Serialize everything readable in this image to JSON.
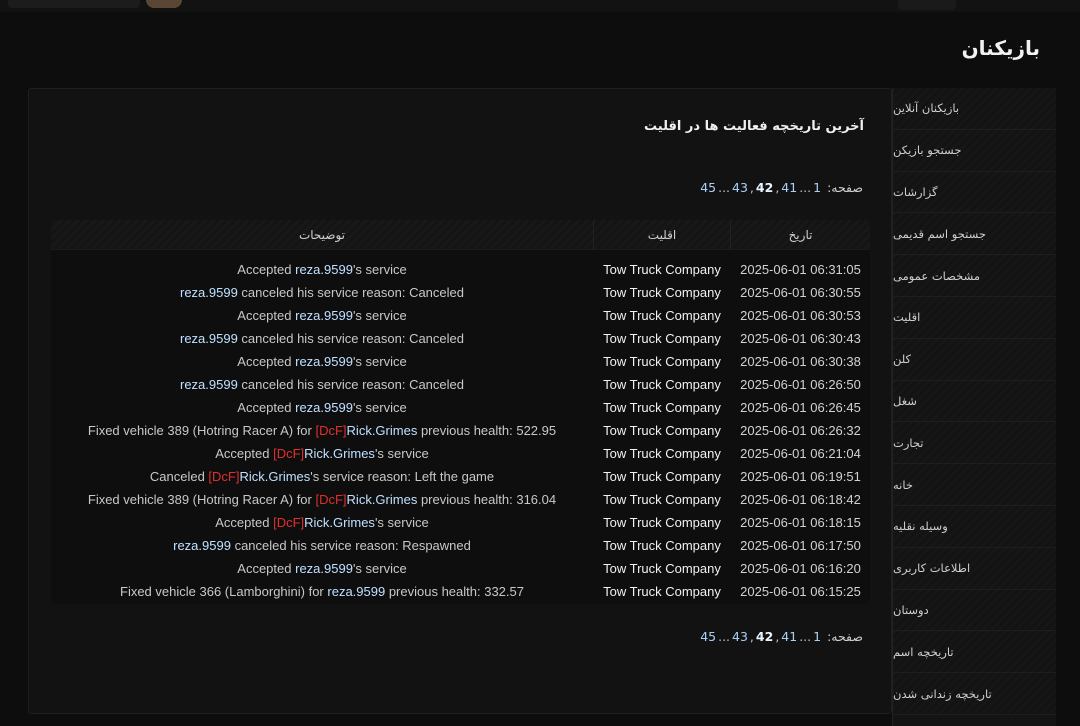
{
  "page": {
    "title": "بازیکنان"
  },
  "sidebar": {
    "items": [
      {
        "label": "بازیکنان آنلاین"
      },
      {
        "label": "جستجو بازیکن"
      },
      {
        "label": "گزارشات"
      },
      {
        "label": "جستجو اسم قدیمی"
      },
      {
        "label": "مشخصات عمومی"
      },
      {
        "label": "اقلیت"
      },
      {
        "label": "کلن"
      },
      {
        "label": "شغل"
      },
      {
        "label": "تجارت"
      },
      {
        "label": "خانه"
      },
      {
        "label": "وسیله نقلیه"
      },
      {
        "label": "اطلاعات کاربری"
      },
      {
        "label": "دوستان"
      },
      {
        "label": "تاریخچه اسم"
      },
      {
        "label": "تاریخچه زندانی شدن"
      }
    ]
  },
  "panel": {
    "title": "آخرین تاریخچه فعالیت ها در اقلیت"
  },
  "pagination": {
    "label": "صفحه:",
    "first": "1",
    "ellipsis": "...",
    "p41": "41",
    "comma1": ",",
    "current": "42",
    "comma2": ",",
    "p43": "43",
    "ellipsis2": "...",
    "last": "45"
  },
  "table": {
    "headers": {
      "date": "تاریخ",
      "faction": "اقلیت",
      "desc": "توضیحات"
    },
    "rows": [
      {
        "date": "2025-06-01 06:31:05",
        "faction": "Tow Truck Company",
        "desc": [
          [
            "t",
            "Accepted "
          ],
          [
            "h",
            "reza.9599"
          ],
          [
            "t",
            "'s service"
          ]
        ]
      },
      {
        "date": "2025-06-01 06:30:55",
        "faction": "Tow Truck Company",
        "desc": [
          [
            "h",
            "reza.9599"
          ],
          [
            "t",
            " canceled his service reason: Canceled"
          ]
        ]
      },
      {
        "date": "2025-06-01 06:30:53",
        "faction": "Tow Truck Company",
        "desc": [
          [
            "t",
            "Accepted "
          ],
          [
            "h",
            "reza.9599"
          ],
          [
            "t",
            "'s service"
          ]
        ]
      },
      {
        "date": "2025-06-01 06:30:43",
        "faction": "Tow Truck Company",
        "desc": [
          [
            "h",
            "reza.9599"
          ],
          [
            "t",
            " canceled his service reason: Canceled"
          ]
        ]
      },
      {
        "date": "2025-06-01 06:30:38",
        "faction": "Tow Truck Company",
        "desc": [
          [
            "t",
            "Accepted "
          ],
          [
            "h",
            "reza.9599"
          ],
          [
            "t",
            "'s service"
          ]
        ]
      },
      {
        "date": "2025-06-01 06:26:50",
        "faction": "Tow Truck Company",
        "desc": [
          [
            "h",
            "reza.9599"
          ],
          [
            "t",
            " canceled his service reason: Canceled"
          ]
        ]
      },
      {
        "date": "2025-06-01 06:26:45",
        "faction": "Tow Truck Company",
        "desc": [
          [
            "t",
            "Accepted "
          ],
          [
            "h",
            "reza.9599"
          ],
          [
            "t",
            "'s service"
          ]
        ]
      },
      {
        "date": "2025-06-01 06:26:32",
        "faction": "Tow Truck Company",
        "desc": [
          [
            "t",
            "Fixed vehicle 389 (Hotring Racer A) for "
          ],
          [
            "r",
            "[DcF]"
          ],
          [
            "h",
            "Rick.Grimes"
          ],
          [
            "t",
            " previous health: 522.95"
          ]
        ]
      },
      {
        "date": "2025-06-01 06:21:04",
        "faction": "Tow Truck Company",
        "desc": [
          [
            "t",
            "Accepted "
          ],
          [
            "r",
            "[DcF]"
          ],
          [
            "h",
            "Rick.Grimes"
          ],
          [
            "t",
            "'s service"
          ]
        ]
      },
      {
        "date": "2025-06-01 06:19:51",
        "faction": "Tow Truck Company",
        "desc": [
          [
            "t",
            "Canceled "
          ],
          [
            "r",
            "[DcF]"
          ],
          [
            "h",
            "Rick.Grimes"
          ],
          [
            "t",
            "'s service reason: Left the game"
          ]
        ]
      },
      {
        "date": "2025-06-01 06:18:42",
        "faction": "Tow Truck Company",
        "desc": [
          [
            "t",
            "Fixed vehicle 389 (Hotring Racer A) for "
          ],
          [
            "r",
            "[DcF]"
          ],
          [
            "h",
            "Rick.Grimes"
          ],
          [
            "t",
            " previous health: 316.04"
          ]
        ]
      },
      {
        "date": "2025-06-01 06:18:15",
        "faction": "Tow Truck Company",
        "desc": [
          [
            "t",
            "Accepted "
          ],
          [
            "r",
            "[DcF]"
          ],
          [
            "h",
            "Rick.Grimes"
          ],
          [
            "t",
            "'s service"
          ]
        ]
      },
      {
        "date": "2025-06-01 06:17:50",
        "faction": "Tow Truck Company",
        "desc": [
          [
            "h",
            "reza.9599"
          ],
          [
            "t",
            " canceled his service reason: Respawned"
          ]
        ]
      },
      {
        "date": "2025-06-01 06:16:20",
        "faction": "Tow Truck Company",
        "desc": [
          [
            "t",
            "Accepted "
          ],
          [
            "h",
            "reza.9599"
          ],
          [
            "t",
            "'s service"
          ]
        ]
      },
      {
        "date": "2025-06-01 06:15:25",
        "faction": "Tow Truck Company",
        "desc": [
          [
            "t",
            "Fixed vehicle 366 (Lamborghini) for "
          ],
          [
            "h",
            "reza.9599"
          ],
          [
            "t",
            " previous health: 332.57"
          ]
        ]
      }
    ]
  },
  "colors": {
    "link": "#bfe0ff",
    "tag": "#e0302d",
    "background": "#0d0d0e"
  }
}
